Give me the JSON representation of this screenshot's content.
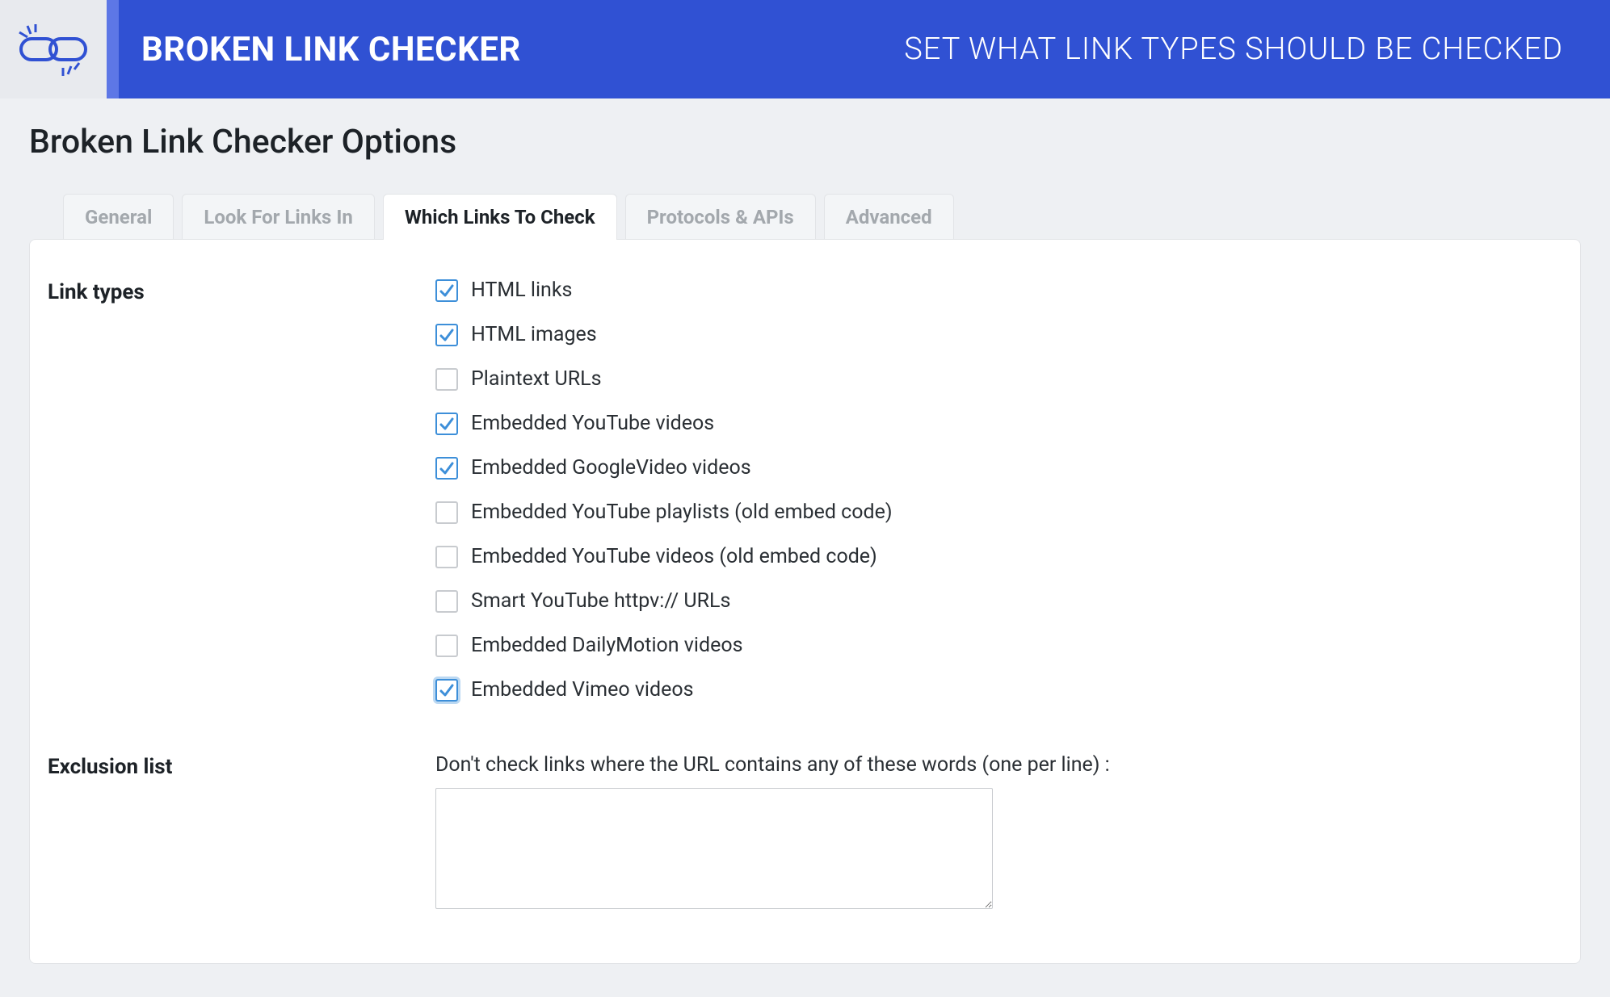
{
  "header": {
    "title": "BROKEN LINK CHECKER",
    "subtitle": "SET WHAT LINK TYPES SHOULD BE CHECKED"
  },
  "page": {
    "title": "Broken Link Checker Options"
  },
  "tabs": [
    {
      "label": "General",
      "active": false
    },
    {
      "label": "Look For Links In",
      "active": false
    },
    {
      "label": "Which Links To Check",
      "active": true
    },
    {
      "label": "Protocols & APIs",
      "active": false
    },
    {
      "label": "Advanced",
      "active": false
    }
  ],
  "sections": {
    "link_types": {
      "label": "Link types",
      "items": [
        {
          "label": "HTML links",
          "checked": true,
          "focused": false
        },
        {
          "label": "HTML images",
          "checked": true,
          "focused": false
        },
        {
          "label": "Plaintext URLs",
          "checked": false,
          "focused": false
        },
        {
          "label": "Embedded YouTube videos",
          "checked": true,
          "focused": false
        },
        {
          "label": "Embedded GoogleVideo videos",
          "checked": true,
          "focused": false
        },
        {
          "label": "Embedded YouTube playlists (old embed code)",
          "checked": false,
          "focused": false
        },
        {
          "label": "Embedded YouTube videos (old embed code)",
          "checked": false,
          "focused": false
        },
        {
          "label": "Smart YouTube httpv:// URLs",
          "checked": false,
          "focused": false
        },
        {
          "label": "Embedded DailyMotion videos",
          "checked": false,
          "focused": false
        },
        {
          "label": "Embedded Vimeo videos",
          "checked": true,
          "focused": true
        }
      ]
    },
    "exclusion": {
      "label": "Exclusion list",
      "help": "Don't check links where the URL contains any of these words (one per line) :",
      "value": ""
    }
  }
}
